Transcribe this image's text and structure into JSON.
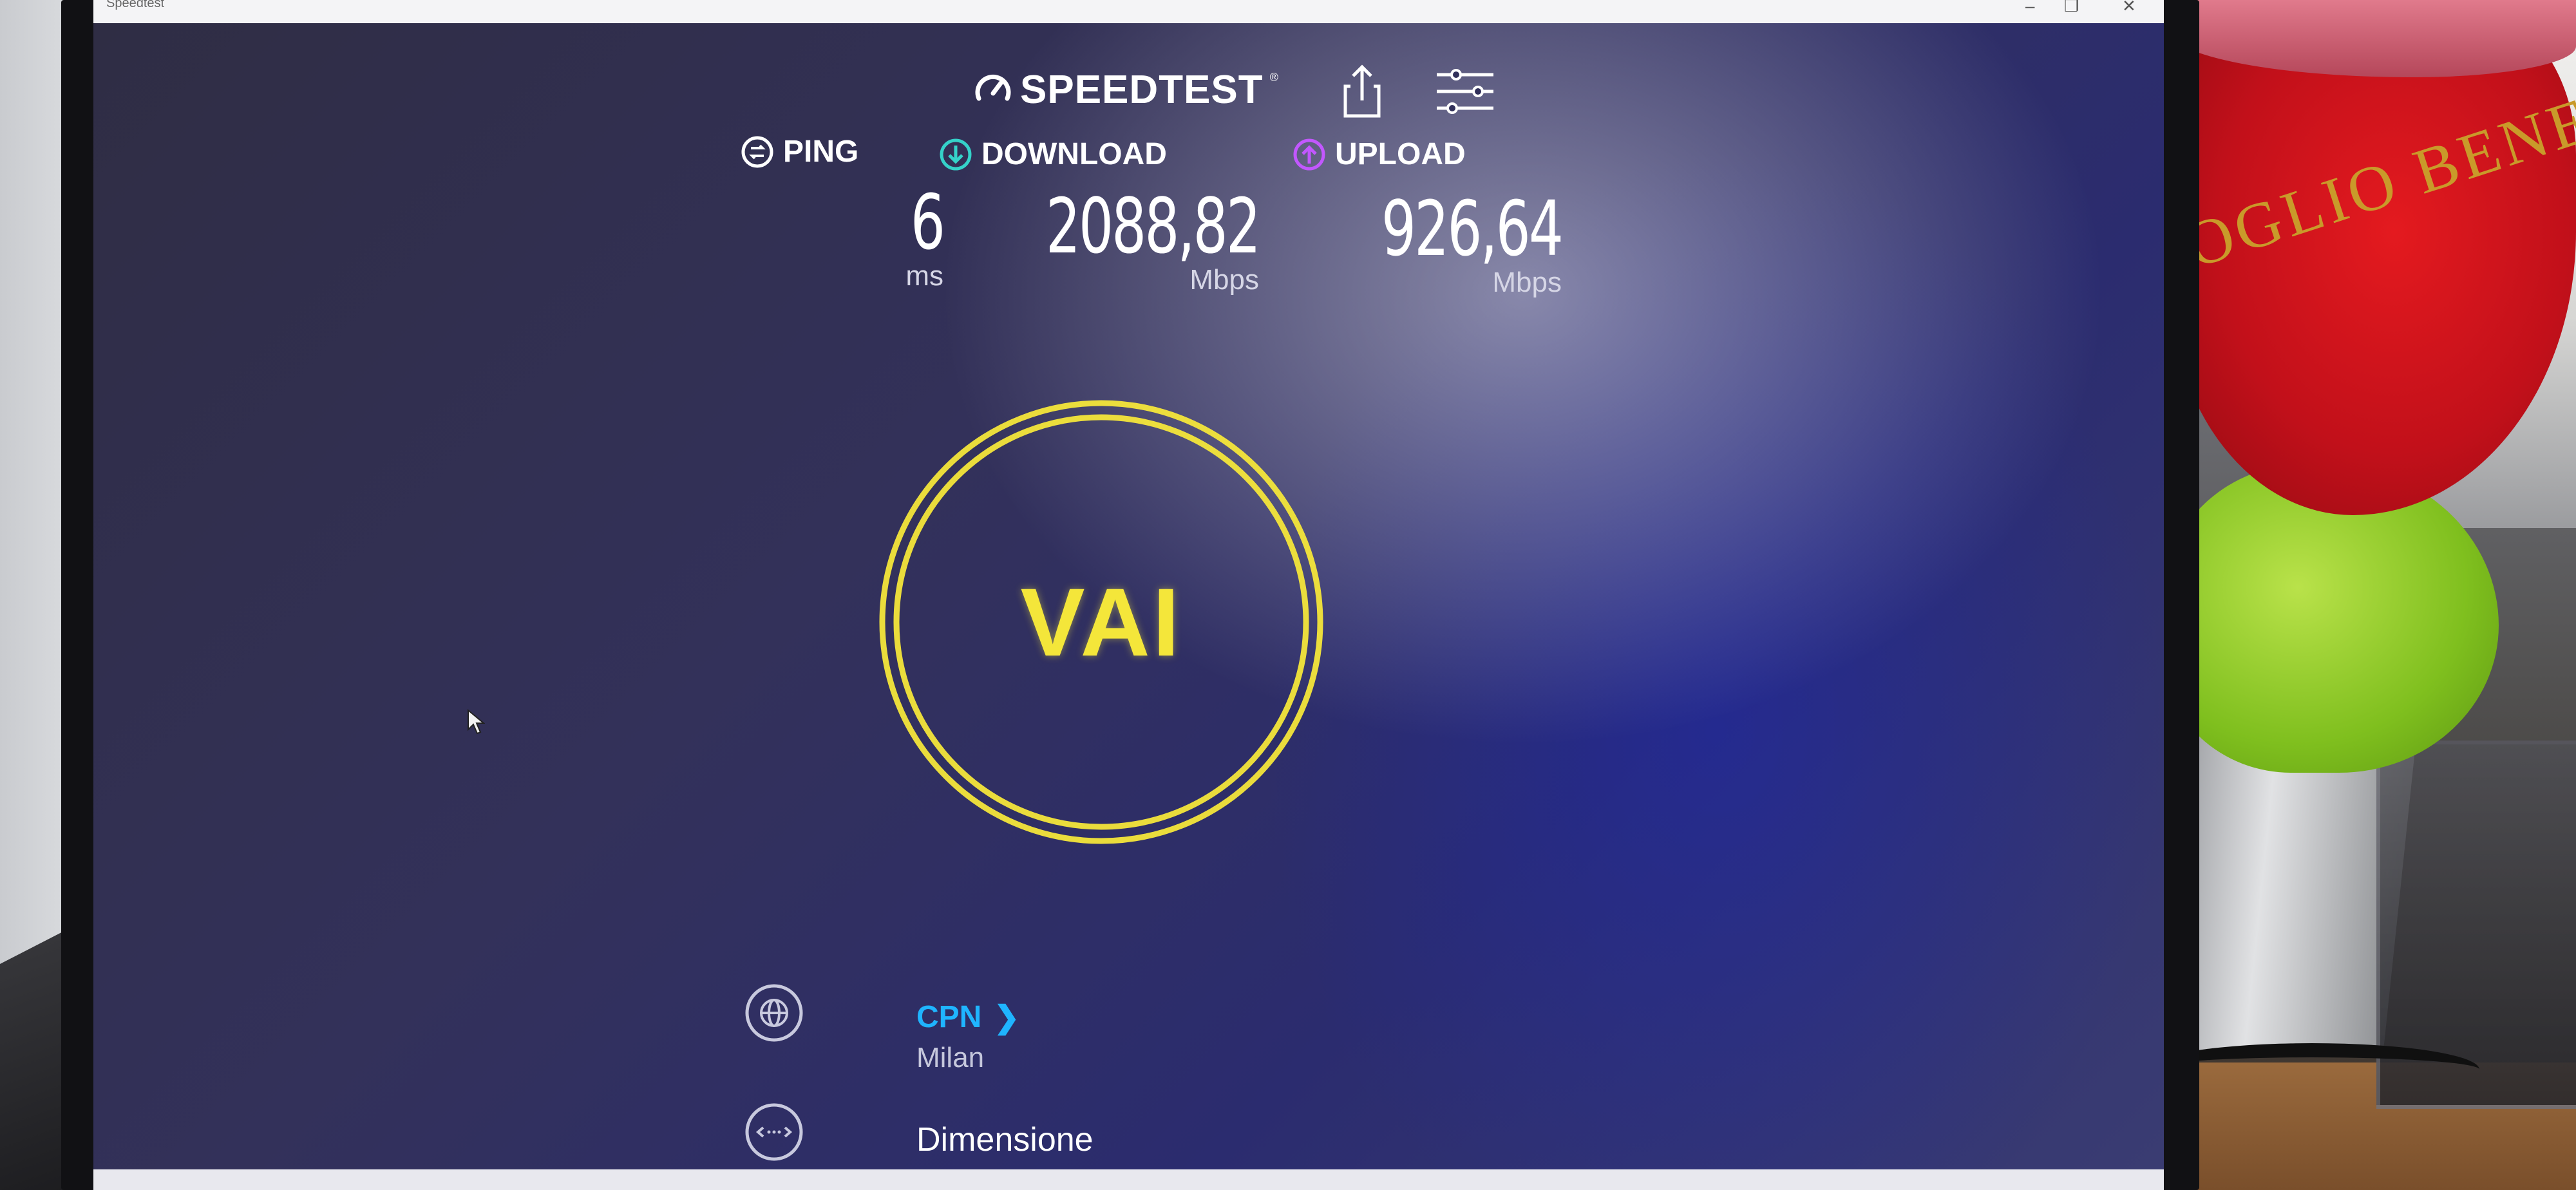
{
  "window": {
    "title": "Speedtest"
  },
  "app": {
    "brand": "SPEEDTEST",
    "brand_mark": "®",
    "accent_color": "#f4e63a",
    "isp_color": "#1fb4ff"
  },
  "toolbar": {
    "share_icon": "share-icon",
    "settings_icon": "settings-sliders-icon"
  },
  "metrics": {
    "ping": {
      "label": "PING",
      "value": "6",
      "unit": "ms",
      "icon": "ping-icon",
      "color": "#ffffff"
    },
    "download": {
      "label": "DOWNLOAD",
      "value": "2088,82",
      "unit": "Mbps",
      "icon": "download-arrow-icon",
      "color": "#35d2c9"
    },
    "upload": {
      "label": "UPLOAD",
      "value": "926,64",
      "unit": "Mbps",
      "icon": "upload-arrow-icon",
      "color": "#c257ff"
    }
  },
  "go_button": {
    "label": "VAI"
  },
  "server": {
    "isp": "CPN",
    "city": "Milan",
    "icon": "globe-icon"
  },
  "connection": {
    "label": "Dimensione",
    "icon": "connection-arrows-icon"
  },
  "scene": {
    "plush_embroidery": "OGLIO BENE"
  }
}
